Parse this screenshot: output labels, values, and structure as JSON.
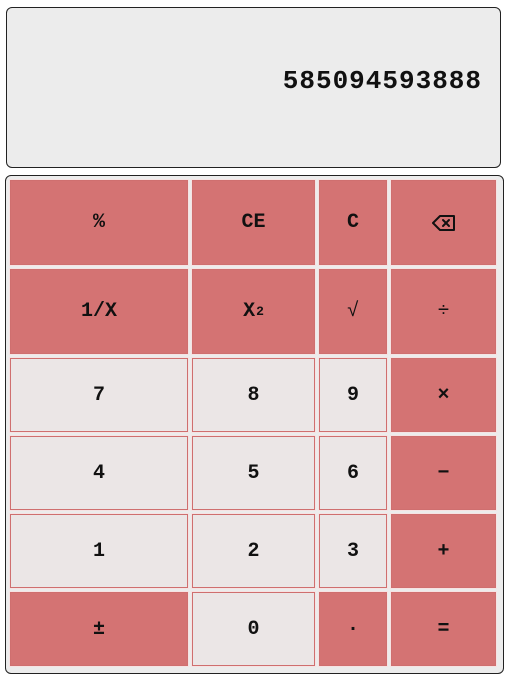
{
  "display": {
    "value": "585094593888"
  },
  "keys": {
    "percent": "%",
    "clear_entry": "CE",
    "clear": "C",
    "backspace_icon": "backspace-icon",
    "reciprocal": "1/X",
    "square_base": "X",
    "square_exp": "2",
    "sqrt": "√",
    "divide": "÷",
    "seven": "7",
    "eight": "8",
    "nine": "9",
    "multiply": "×",
    "four": "4",
    "five": "5",
    "six": "6",
    "minus": "−",
    "one": "1",
    "two": "2",
    "three": "3",
    "plus": "+",
    "negate": "±",
    "zero": "0",
    "decimal": "·",
    "equals": "="
  },
  "colors": {
    "operator_key": "#d47373",
    "number_key": "#ebe6e6",
    "display_bg": "#ececec"
  }
}
